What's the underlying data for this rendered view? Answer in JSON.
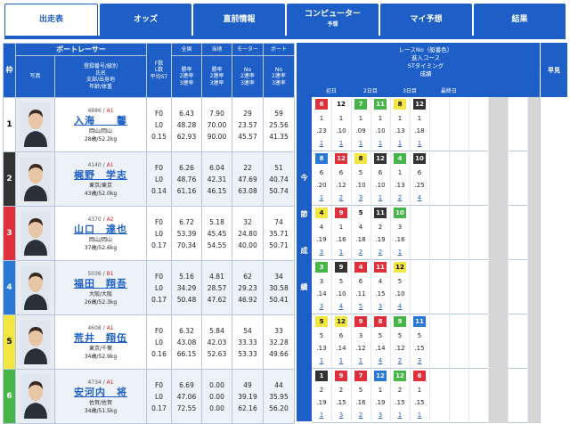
{
  "tabs": [
    {
      "label": "出走表",
      "active": true
    },
    {
      "label": "オッズ"
    },
    {
      "label": "直前情報"
    },
    {
      "label": "コンピューター",
      "sub": "予想"
    },
    {
      "label": "マイ予想"
    },
    {
      "label": "結果"
    }
  ],
  "header": {
    "waku": "枠",
    "photo": "写真",
    "racer_group": "ボートレーサー",
    "racer_sub": "登録番号/級別\n氏名\n支部/出身地\n年齢/体重",
    "fst": "F数\nL数\n平均ST",
    "zenkoku_title": "全国",
    "zenkoku_sub": "勝率\n2連率\n3連率",
    "touchi_title": "当地",
    "touchi_sub": "勝率\n2連率\n3連率",
    "motor_title": "モーター",
    "motor_sub": "No\n2連率\n3連率",
    "boat_title": "ボート",
    "boat_sub": "No\n2連率\n3連率",
    "race_info": "レースNo（艇番色）\n進入コース\nSTタイミング\n成績",
    "days": [
      "初日",
      "2日目",
      "3日目",
      "最終日"
    ],
    "yoso": "早見",
    "side_label": [
      "今",
      "節",
      "成",
      "績"
    ]
  },
  "racers": [
    {
      "waku": "1",
      "reg": "4886",
      "cls": "A1",
      "name": "入海　　馨",
      "branch": "岡山/岡山",
      "age": "28歳/52.2kg",
      "f": "F0",
      "l": "L0",
      "st": "0.15",
      "zen": [
        "6.43",
        "48.28",
        "62.93"
      ],
      "tou": [
        "7.90",
        "70.00",
        "90.00"
      ],
      "mot": [
        "29",
        "23.57",
        "45.57"
      ],
      "bt": [
        "59",
        "25.56",
        "41.35"
      ],
      "boats": [
        {
          "n": "6",
          "c": "c3"
        },
        {
          "n": "12",
          "c": "c1"
        },
        {
          "n": "7",
          "c": "c6"
        },
        {
          "n": "11",
          "c": "c6"
        },
        {
          "n": "8",
          "c": "c5"
        },
        {
          "n": "12",
          "c": "c2"
        }
      ],
      "course": [
        "1",
        "1",
        "1",
        "1",
        "1",
        "1"
      ],
      "st_t": [
        ".23",
        ".10",
        ".09",
        ".10",
        ".13",
        ".18"
      ],
      "res": [
        "1",
        "1",
        "1",
        "1",
        "1",
        "1"
      ]
    },
    {
      "waku": "2",
      "reg": "4140",
      "cls": "A1",
      "name": "梶野　学志",
      "branch": "東京/東京",
      "age": "43歳/52.0kg",
      "f": "F0",
      "l": "L0",
      "st": "0.14",
      "zen": [
        "6.26",
        "48.76",
        "61.16"
      ],
      "tou": [
        "6.04",
        "42.31",
        "46.15"
      ],
      "mot": [
        "22",
        "47.69",
        "63.08"
      ],
      "bt": [
        "51",
        "40.74",
        "50.74"
      ],
      "boats": [
        {
          "n": "8",
          "c": "c4"
        },
        {
          "n": "12",
          "c": "c3"
        },
        {
          "n": "8",
          "c": "c5"
        },
        {
          "n": "12",
          "c": "c2"
        },
        {
          "n": "4",
          "c": "c6"
        },
        {
          "n": "10",
          "c": "c2"
        }
      ],
      "course": [
        "6",
        "6",
        "5",
        "6",
        "1",
        "6"
      ],
      "st_t": [
        ".20",
        ".12",
        ".10",
        ".10",
        ".13",
        ".25"
      ],
      "res": [
        "1",
        "2",
        "3",
        "1",
        "2",
        "4"
      ]
    },
    {
      "waku": "3",
      "reg": "4370",
      "cls": "A2",
      "name": "山口　達也",
      "branch": "岡山/岡山",
      "age": "37歳/52.6kg",
      "f": "F0",
      "l": "L0",
      "st": "0.17",
      "zen": [
        "6.72",
        "53.39",
        "70.34"
      ],
      "tou": [
        "5.18",
        "45.45",
        "54.55"
      ],
      "mot": [
        "32",
        "24.80",
        "40.00"
      ],
      "bt": [
        "74",
        "35.71",
        "50.71"
      ],
      "boats": [
        {
          "n": "4",
          "c": "c5"
        },
        {
          "n": "9",
          "c": "c3"
        },
        {
          "n": "5",
          "c": "c1"
        },
        {
          "n": "11",
          "c": "c2"
        },
        {
          "n": "10",
          "c": "c6"
        }
      ],
      "course": [
        "4",
        "1",
        "4",
        "2",
        "3"
      ],
      "st_t": [
        ".19",
        ".16",
        ".18",
        ".19",
        ".16"
      ],
      "res": [
        "3",
        "1",
        "2",
        "2",
        "1"
      ]
    },
    {
      "waku": "4",
      "reg": "5036",
      "cls": "B1",
      "name": "福田　翔吾",
      "branch": "大阪/大阪",
      "age": "26歳/52.3kg",
      "f": "F0",
      "l": "L0",
      "st": "0.17",
      "zen": [
        "5.16",
        "34.29",
        "50.48"
      ],
      "tou": [
        "4.81",
        "28.57",
        "47.62"
      ],
      "mot": [
        "62",
        "29.23",
        "46.92"
      ],
      "bt": [
        "34",
        "30.58",
        "50.41"
      ],
      "boats": [
        {
          "n": "3",
          "c": "c6"
        },
        {
          "n": "9",
          "c": "c2"
        },
        {
          "n": "4",
          "c": "c3"
        },
        {
          "n": "11",
          "c": "c3"
        },
        {
          "n": "12",
          "c": "c5"
        }
      ],
      "course": [
        "3",
        "5",
        "6",
        "4",
        "5"
      ],
      "st_t": [
        ".14",
        ".10",
        ".11",
        ".15",
        ".10"
      ],
      "res": [
        "3",
        "4",
        "5",
        "3",
        "4"
      ]
    },
    {
      "waku": "5",
      "reg": "4608",
      "cls": "A1",
      "name": "荒井　翔伍",
      "branch": "東京/千葉",
      "age": "34歳/52.9kg",
      "f": "F0",
      "l": "L0",
      "st": "0.16",
      "zen": [
        "6.32",
        "43.08",
        "66.15"
      ],
      "tou": [
        "5.84",
        "42.03",
        "52.63"
      ],
      "mot": [
        "54",
        "33.33",
        "53.33"
      ],
      "bt": [
        "33",
        "32.28",
        "49.66"
      ],
      "boats": [
        {
          "n": "5",
          "c": "c5"
        },
        {
          "n": "12",
          "c": "c5"
        },
        {
          "n": "9",
          "c": "c3"
        },
        {
          "n": "8",
          "c": "c3"
        },
        {
          "n": "9",
          "c": "c6"
        },
        {
          "n": "11",
          "c": "c4"
        }
      ],
      "course": [
        "5",
        "6",
        "3",
        "5",
        "5",
        "5"
      ],
      "st_t": [
        ".13",
        ".14",
        ".12",
        ".14",
        ".12",
        ".15"
      ],
      "res": [
        "1",
        "1",
        "1",
        "4",
        "2",
        "3"
      ]
    },
    {
      "waku": "6",
      "reg": "4734",
      "cls": "A1",
      "name": "安河内　将",
      "branch": "佐賀/佐賀",
      "age": "34歳/51.5kg",
      "f": "F0",
      "l": "L0",
      "st": "0.17",
      "zen": [
        "6.69",
        "47.06",
        "72.55"
      ],
      "tou": [
        "0.00",
        "0.00",
        "0.00"
      ],
      "mot": [
        "49",
        "39.19",
        "62.16"
      ],
      "bt": [
        "44",
        "35.95",
        "56.20"
      ],
      "boats": [
        {
          "n": "1",
          "c": "c2"
        },
        {
          "n": "9",
          "c": "c3"
        },
        {
          "n": "7",
          "c": "c3"
        },
        {
          "n": "12",
          "c": "c4"
        },
        {
          "n": "12",
          "c": "c6"
        },
        {
          "n": "6",
          "c": "c3"
        }
      ],
      "course": [
        "2",
        "2",
        "5",
        "1",
        "2",
        "1"
      ],
      "st_t": [
        ".19",
        ".15",
        ".16",
        ".19",
        ".15",
        ".15"
      ],
      "res": [
        "1",
        "3",
        "2",
        "3",
        "1",
        "1"
      ]
    }
  ]
}
